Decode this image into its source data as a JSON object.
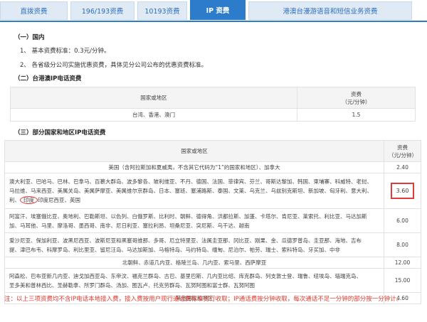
{
  "tabs": [
    "直拨资费",
    "196/193资费",
    "10193资费",
    "IP 资费",
    "港澳台漫游语音和短信业务资费"
  ],
  "sections": {
    "domestic_title": "（一）国内",
    "domestic_lines": [
      "1、 基本资费标准：0.3元/分钟。",
      "2、 各省级分公司实施优惠资费，具体见分公司公布的优惠资费标准。"
    ],
    "hmt_title": "（二）台港澳IP电话资费",
    "intl_title": "（三）部分国家和地区IP电话资费"
  },
  "table1": {
    "header_region": "国家或地区",
    "header_price_1": "资费",
    "header_price_2": "（元/分钟）",
    "row_region": "台湾、香港、澳门",
    "row_price": "1.5"
  },
  "table2": {
    "header_region": "国家或地区",
    "header_price_1": "资费",
    "header_price_2": "（元/分钟）",
    "rows": [
      {
        "region": "美国（含阿拉斯加和夏威夷，不含其它代码为“1”的国家和地区）、加拿大",
        "price": "2.40"
      },
      {
        "region_lines": [
          "澳大利亚、巴哈马、巴林、巴拿马、百慕大群岛、波多黎各、玻利维亚、不丹、德国、法国、菲律宾、芬兰、哥斯达黎加、韩国、柬埔寨、科威特、老挝、",
          "马拉维、马来西亚、美属关岛、美属萨摩亚、美属维尔京群岛、日本、塞班、塞浦路斯、泰国、文莱、乌克兰、乌兹别克斯坦、新加坡、匈牙利、意大利、",
          "利、"
        ],
        "circled": "印度",
        "region_tail": "印度尼西亚、英国",
        "price": "3.60"
      },
      {
        "region_lines": [
          "阿富汗、埃塞俄比亚、奥地利、巴勒斯坦、以色列、白俄罗斯、比利时、朝鲜、德得角、洪都拉斯、加蓬、卡塔尔、肯尼亚、莱索托、利比亚、马达加斯",
          "加、马耳他、马里、摩洛哥、墨西哥、南非、尼日利亚、塞拉利昂、坦桑尼亚、突尼斯、乌干达、越南"
        ],
        "price": "6.00"
      },
      {
        "region_lines": [
          "爱沙尼亚、保加利亚、波黑尼西亚、波斯尼亚和黑塞哥维那、多哥、厄立特里亚、法属圭亚那、冈比亚、刚果、金、瓜德罗普岛、圭亚那、海地、吉布",
          "提、津巴布韦、科摩罗岛、利比里亚、留尼汪岛、马达加斯加、马格特岛、马约特岛、缅甸、尼泊尔、帕劳、瑞士、索科特岛、牙买加、中非"
        ],
        "price": "8.00"
      },
      {
        "region": "北朝鲜、赤道几内亚、格陵兰岛、几内亚、索马里、西萨摩亚",
        "price": "12.00"
      },
      {
        "region_lines": [
          "阿森松、巴布亚新几内亚、迪戈加西亚岛、东帝汶、福克兰群岛、古巴、基里巴斯、几内亚比绍、库克群岛、列支敦士登、瑞鲁、纽埃岛、瑙瑞克岛、",
          "圣多美和普林西比、圣赫勒拿、所罗门群岛、汤加、图瓦卢、托克劳群岛、瓦努阿图和富士群、瓦努阿图"
        ],
        "price": "15.00"
      },
      {
        "region": "其他国家和地区",
        "price": "4.60"
      }
    ]
  },
  "note": "注：以上三项资费均不含IP电话本地接入费，接入费按用户现行通话费标准另行收取；IP通话费按分钟收取，每次通话不足一分钟的部分按一分钟计。",
  "colors": {
    "accent": "#2d7ccc",
    "note_red": "#e03a2f",
    "highlight": "#e03c3c"
  }
}
